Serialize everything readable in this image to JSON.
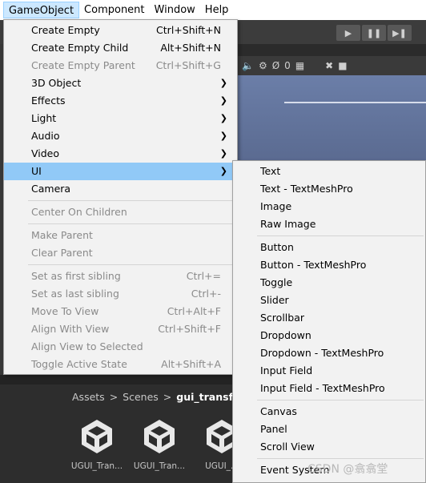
{
  "menubar": {
    "items": [
      "GameObject",
      "Component",
      "Window",
      "Help"
    ]
  },
  "toolbar": {
    "play_icon": "play-icon",
    "pause_icon": "pause-icon",
    "step_icon": "step-icon"
  },
  "scene": {
    "gizmo_count": "0"
  },
  "gameobject_menu": {
    "items": [
      {
        "label": "Create Empty",
        "shortcut": "Ctrl+Shift+N"
      },
      {
        "label": "Create Empty Child",
        "shortcut": "Alt+Shift+N"
      },
      {
        "label": "Create Empty Parent",
        "shortcut": "Ctrl+Shift+G"
      },
      {
        "label": "3D Object"
      },
      {
        "label": "Effects"
      },
      {
        "label": "Light"
      },
      {
        "label": "Audio"
      },
      {
        "label": "Video"
      },
      {
        "label": "UI"
      },
      {
        "label": "Camera"
      },
      {
        "label": "Center On Children"
      },
      {
        "label": "Make Parent"
      },
      {
        "label": "Clear Parent"
      },
      {
        "label": "Set as first sibling",
        "shortcut": "Ctrl+="
      },
      {
        "label": "Set as last sibling",
        "shortcut": "Ctrl+-"
      },
      {
        "label": "Move To View",
        "shortcut": "Ctrl+Alt+F"
      },
      {
        "label": "Align With View",
        "shortcut": "Ctrl+Shift+F"
      },
      {
        "label": "Align View to Selected"
      },
      {
        "label": "Toggle Active State",
        "shortcut": "Alt+Shift+A"
      }
    ]
  },
  "ui_submenu": {
    "items": [
      "Text",
      "Text - TextMeshPro",
      "Image",
      "Raw Image",
      "Button",
      "Button - TextMeshPro",
      "Toggle",
      "Slider",
      "Scrollbar",
      "Dropdown",
      "Dropdown - TextMeshPro",
      "Input Field",
      "Input Field - TextMeshPro",
      "Canvas",
      "Panel",
      "Scroll View",
      "Event System"
    ]
  },
  "project": {
    "breadcrumb": [
      "Assets",
      "Scenes",
      "gui_transform"
    ],
    "assets": [
      "UGUI_Tran...",
      "UGUI_Tran...",
      "UGUI_..."
    ]
  },
  "watermark": "CSDN @翕翕堂"
}
